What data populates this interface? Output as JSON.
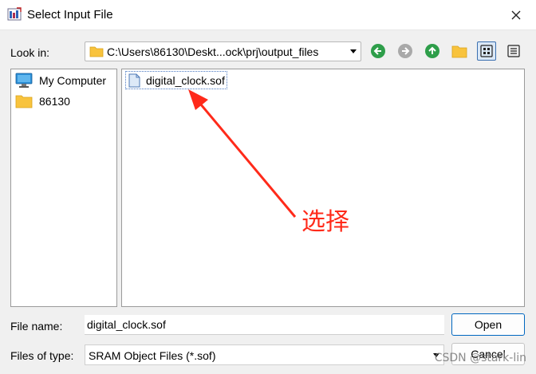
{
  "window": {
    "title": "Select Input File",
    "app_icon": "quartus-app-icon",
    "close_icon": "close-icon"
  },
  "toolbar": {
    "lookin_label": "Look in:",
    "path": "C:\\Users\\86130\\Deskt...ock\\prj\\output_files",
    "buttons": [
      {
        "name": "back-button",
        "icon": "arrow-left-circle-icon"
      },
      {
        "name": "forward-button",
        "icon": "arrow-right-circle-icon"
      },
      {
        "name": "up-button",
        "icon": "arrow-up-circle-icon"
      },
      {
        "name": "new-folder-button",
        "icon": "folder-icon"
      },
      {
        "name": "icon-view-button",
        "icon": "grid-icon",
        "active": true
      },
      {
        "name": "detail-view-button",
        "icon": "list-icon",
        "active": false
      }
    ]
  },
  "sidebar": {
    "items": [
      {
        "label": "My Computer",
        "icon": "computer-icon"
      },
      {
        "label": "86130",
        "icon": "folder-icon"
      }
    ]
  },
  "file_list": {
    "items": [
      {
        "name": "digital_clock.sof",
        "icon": "file-icon",
        "selected": true
      }
    ]
  },
  "annotation": {
    "text": "选择",
    "color": "#ff2a1a"
  },
  "form": {
    "file_name_label": "File name:",
    "file_name_value": "digital_clock.sof",
    "file_type_label": "Files of type:",
    "file_type_value": "SRAM Object Files (*.sof)"
  },
  "buttons": {
    "open": "Open",
    "cancel": "Cancel"
  },
  "watermark": "CSDN @stark-lin",
  "colors": {
    "accent": "#0067c0",
    "nav_green": "#2e9e4a",
    "folder_yellow": "#f8c33d"
  }
}
